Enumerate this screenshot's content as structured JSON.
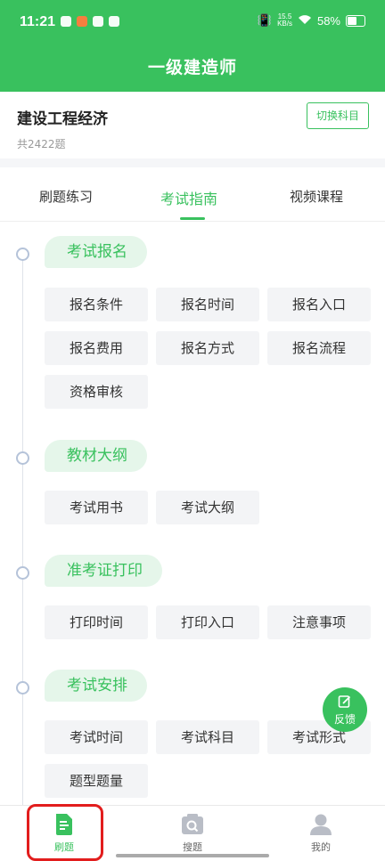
{
  "status_bar": {
    "time": "11:21",
    "net_speed_value": "15.5",
    "net_speed_unit": "KB/s",
    "battery": "58%"
  },
  "header": {
    "title": "一级建造师"
  },
  "subject": {
    "name": "建设工程经济",
    "count": "共2422题",
    "switch_label": "切换科目"
  },
  "tabs": [
    {
      "label": "刷题练习",
      "active": false
    },
    {
      "label": "考试指南",
      "active": true
    },
    {
      "label": "视频课程",
      "active": false
    }
  ],
  "sections": [
    {
      "title": "考试报名",
      "items": [
        "报名条件",
        "报名时间",
        "报名入口",
        "报名费用",
        "报名方式",
        "报名流程",
        "资格审核"
      ]
    },
    {
      "title": "教材大纲",
      "items": [
        "考试用书",
        "考试大纲"
      ]
    },
    {
      "title": "准考证打印",
      "items": [
        "打印时间",
        "打印入口",
        "注意事项"
      ]
    },
    {
      "title": "考试安排",
      "items": [
        "考试时间",
        "考试科目",
        "考试形式",
        "题型题量"
      ]
    }
  ],
  "feedback": {
    "label": "反馈"
  },
  "bottom_nav": [
    {
      "label": "刷题",
      "icon": "document-icon",
      "active": true
    },
    {
      "label": "搜题",
      "icon": "search-camera-icon",
      "active": false
    },
    {
      "label": "我的",
      "icon": "user-icon",
      "active": false
    }
  ],
  "colors": {
    "primary": "#39c15e",
    "pill_bg": "#e5f6ea",
    "item_bg": "#f3f4f6",
    "highlight": "#e21d1d"
  }
}
